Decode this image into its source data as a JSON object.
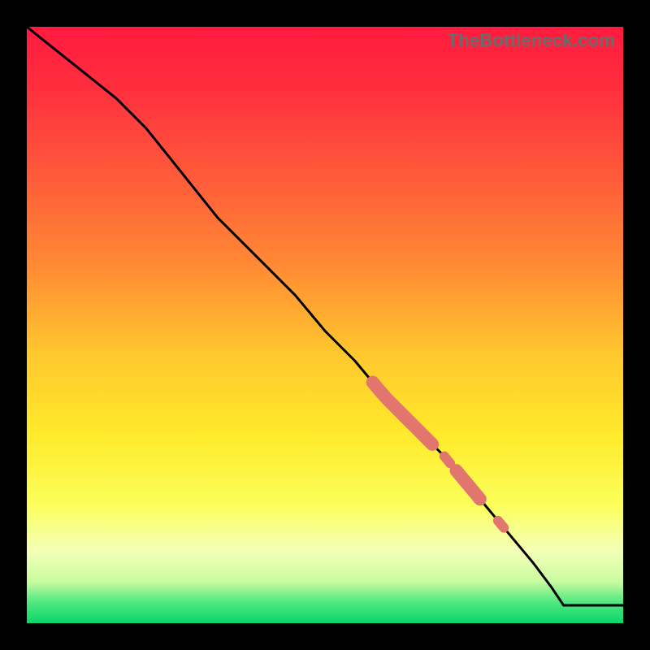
{
  "watermark": "TheBottleneck.com",
  "colors": {
    "gradient_stops": [
      {
        "t": 0.0,
        "c": "#ff1a3e"
      },
      {
        "t": 0.1,
        "c": "#ff2e3e"
      },
      {
        "t": 0.25,
        "c": "#ff5a3a"
      },
      {
        "t": 0.4,
        "c": "#ff8a34"
      },
      {
        "t": 0.55,
        "c": "#ffc82e"
      },
      {
        "t": 0.68,
        "c": "#ffe92a"
      },
      {
        "t": 0.8,
        "c": "#fcff5a"
      },
      {
        "t": 0.88,
        "c": "#f3ffb8"
      },
      {
        "t": 0.93,
        "c": "#c9fca0"
      },
      {
        "t": 0.965,
        "c": "#4fe87f"
      },
      {
        "t": 1.0,
        "c": "#09d66a"
      }
    ],
    "line": "#000000",
    "highlight": "#e2766e"
  },
  "chart_data": {
    "type": "line",
    "title": "",
    "xlabel": "",
    "ylabel": "",
    "xlim": [
      0,
      100
    ],
    "ylim": [
      0,
      100
    ],
    "grid": false,
    "x": [
      0,
      5,
      10,
      15,
      20,
      24,
      28,
      32,
      36,
      40,
      45,
      50,
      55,
      60,
      65,
      70,
      75,
      80,
      85,
      88,
      90,
      95,
      100
    ],
    "values": [
      100,
      96,
      92,
      88,
      83,
      78,
      73,
      68,
      64,
      60,
      55,
      49,
      44,
      38,
      33,
      28,
      22,
      16,
      10,
      6,
      3,
      3,
      3
    ],
    "highlights": [
      {
        "x0": 58,
        "x1": 68,
        "thick": true
      },
      {
        "x0": 70,
        "x1": 71,
        "thick": false
      },
      {
        "x0": 72,
        "x1": 76,
        "thick": true
      },
      {
        "x0": 79,
        "x1": 80,
        "thick": false
      }
    ]
  }
}
